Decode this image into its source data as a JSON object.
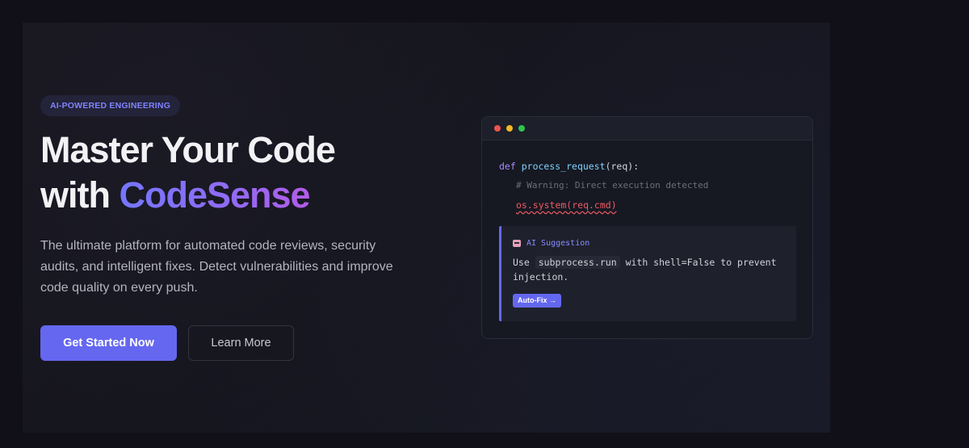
{
  "hero": {
    "badge": "AI-POWERED ENGINEERING",
    "headline_line1": "Master Your Code",
    "headline_with": "with ",
    "headline_brand": "CodeSense",
    "description": "The ultimate platform for automated code reviews, security audits, and intelligent fixes. Detect vulnerabilities and improve code quality on every push.",
    "primary_button": "Get Started Now",
    "secondary_button": "Learn More"
  },
  "code_preview": {
    "keyword_def": "def",
    "function_name": "process_request",
    "function_args": "(req):",
    "comment": "# Warning: Direct execution detected",
    "vulnerable_line": "os.system(req.cmd)",
    "suggestion": {
      "icon": "robot-icon",
      "title": "AI Suggestion",
      "text_before": "Use ",
      "inline_code": "subprocess.run",
      "text_after": " with shell=False to prevent injection.",
      "action": "Auto-Fix →"
    }
  },
  "colors": {
    "accent": "#6567f0",
    "brand_gradient_start": "#7477ff",
    "brand_gradient_end": "#b25ce8",
    "danger": "#ef5b63"
  }
}
